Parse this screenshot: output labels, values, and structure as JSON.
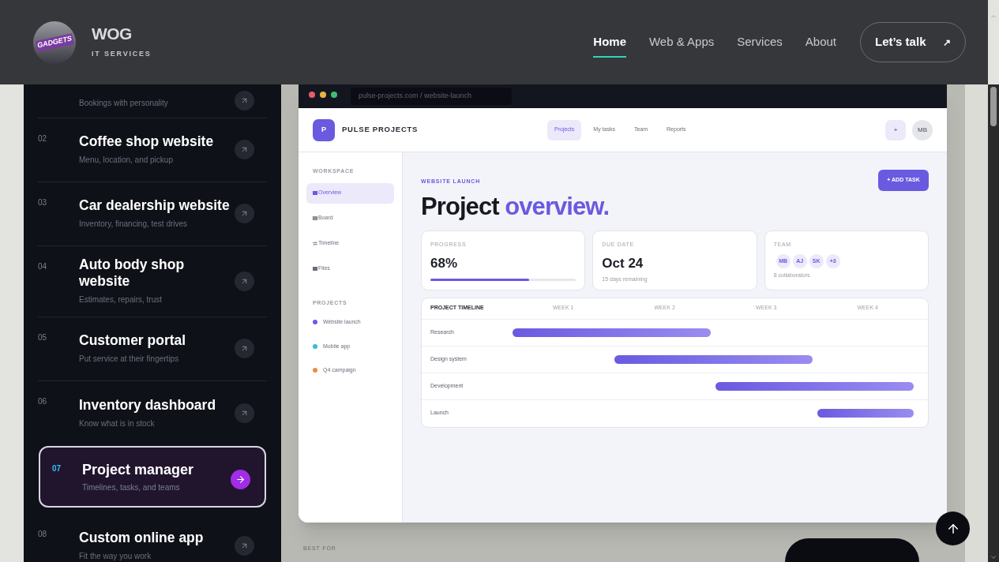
{
  "header": {
    "logo_text": "GADGETS",
    "brand": "WOG",
    "tagline": "IT SERVICES",
    "nav": [
      {
        "label": "Home",
        "selected": true
      },
      {
        "label": "Web & Apps",
        "selected": false
      },
      {
        "label": "Services",
        "selected": false
      },
      {
        "label": "About",
        "selected": false
      }
    ],
    "cta": {
      "label": "Let’s talk",
      "icon": "↗"
    }
  },
  "projects": [
    {
      "subtitle": "Bookings with personality",
      "selected": false
    },
    {
      "number": "02",
      "title": "Coffee shop website",
      "subtitle": "Menu, location, and pickup",
      "selected": false
    },
    {
      "number": "03",
      "title": "Car dealership website",
      "subtitle": "Inventory, financing, test drives",
      "selected": false
    },
    {
      "number": "04",
      "title": "Auto body shop website",
      "subtitle": "Estimates, repairs, trust",
      "selected": false
    },
    {
      "number": "05",
      "title": "Customer portal",
      "subtitle": "Put service at their fingertips",
      "selected": false
    },
    {
      "number": "06",
      "title": "Inventory dashboard",
      "subtitle": "Know what is in stock",
      "selected": false
    },
    {
      "number": "07",
      "title": "Project manager",
      "subtitle": "Timelines, tasks, and teams",
      "selected": true
    },
    {
      "number": "08",
      "title": "Custom online app",
      "subtitle": "Fit the way you work",
      "selected": false
    }
  ],
  "mockup": {
    "url": "pulse-projects.com / website-launch",
    "app": {
      "logo": "P",
      "name": "PULSE PROJECTS",
      "tabs": [
        {
          "label": "Projects",
          "selected": true
        },
        {
          "label": "My tasks",
          "selected": false
        },
        {
          "label": "Team",
          "selected": false
        },
        {
          "label": "Reports",
          "selected": false
        }
      ],
      "add_button": "+",
      "avatar": "MB",
      "sidebar": {
        "workspace_heading": "WORKSPACE",
        "items": [
          {
            "label": "Overview",
            "selected": true
          },
          {
            "label": "Board",
            "selected": false
          },
          {
            "label": "Timeline",
            "selected": false
          },
          {
            "label": "Files",
            "selected": false
          }
        ],
        "projects_heading": "PROJECTS",
        "projects": [
          {
            "label": "Website launch",
            "color": "#6b5ce7"
          },
          {
            "label": "Mobile app",
            "color": "#3cb8d6"
          },
          {
            "label": "Q4 campaign",
            "color": "#f08c3c"
          }
        ]
      },
      "eyebrow": "WEBSITE LAUNCH",
      "title": "Project",
      "title_accent": "overview.",
      "add_task": "+ ADD TASK",
      "progress": {
        "label": "PROGRESS",
        "value": "68%",
        "level": 0.68
      },
      "due": {
        "label": "DUE DATE",
        "value": "Oct 24",
        "note": "15 days remaining"
      },
      "team": {
        "label": "TEAM",
        "avatars": [
          "MB",
          "AJ",
          "SK",
          "+3"
        ],
        "note": "8 collaborators"
      },
      "timeline": {
        "heading": "PROJECT TIMELINE",
        "weeks": [
          "WEEK 1",
          "WEEK 2",
          "WEEK 3",
          "WEEK 4"
        ],
        "rows": [
          {
            "name": "Research"
          },
          {
            "name": "Design system"
          },
          {
            "name": "Development"
          },
          {
            "name": "Launch"
          }
        ]
      }
    }
  },
  "best_for": "BEST FOR"
}
